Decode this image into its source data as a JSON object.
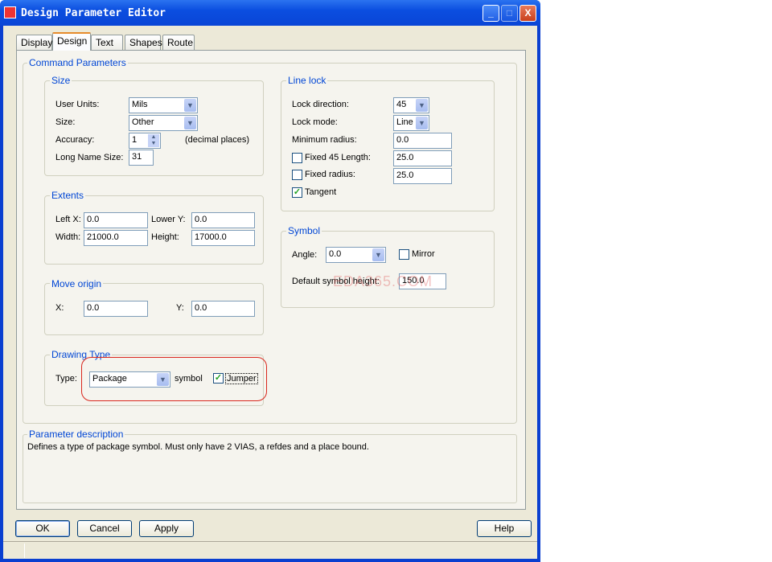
{
  "window": {
    "title": "Design Parameter Editor"
  },
  "tabs": [
    {
      "label": "Display"
    },
    {
      "label": "Design"
    },
    {
      "label": "Text"
    },
    {
      "label": "Shapes"
    },
    {
      "label": "Route"
    }
  ],
  "command_parameters": {
    "label": "Command Parameters"
  },
  "size": {
    "label": "Size",
    "user_units_label": "User Units:",
    "user_units": "Mils",
    "size_label": "Size:",
    "size": "Other",
    "accuracy_label": "Accuracy:",
    "accuracy": "1",
    "accuracy_hint": "(decimal places)",
    "long_name_label": "Long Name Size:",
    "long_name": "31"
  },
  "extents": {
    "label": "Extents",
    "left_x_label": "Left X:",
    "left_x": "0.0",
    "lower_y_label": "Lower Y:",
    "lower_y": "0.0",
    "width_label": "Width:",
    "width": "21000.0",
    "height_label": "Height:",
    "height": "17000.0"
  },
  "move_origin": {
    "label": "Move origin",
    "x_label": "X:",
    "x": "0.0",
    "y_label": "Y:",
    "y": "0.0"
  },
  "drawing_type": {
    "label": "Drawing Type",
    "type_label": "Type:",
    "type": "Package",
    "symbol_label": "symbol",
    "jumper_label": "Jumper",
    "jumper_checked": true
  },
  "line_lock": {
    "label": "Line lock",
    "lock_direction_label": "Lock direction:",
    "lock_direction": "45",
    "lock_mode_label": "Lock mode:",
    "lock_mode": "Line",
    "min_radius_label": "Minimum radius:",
    "min_radius": "0.0",
    "fixed45_label": "Fixed 45 Length:",
    "fixed45": "25.0",
    "fixed_radius_label": "Fixed radius:",
    "fixed_radius": "25.0",
    "tangent_label": "Tangent"
  },
  "symbol": {
    "label": "Symbol",
    "angle_label": "Angle:",
    "angle": "0.0",
    "mirror_label": "Mirror",
    "default_height_label": "Default symbol height:",
    "default_height": "150.0"
  },
  "watermark": "EDA365.COM",
  "description": {
    "label": "Parameter description",
    "text": "Defines a type of package symbol.  Must only have 2 VIAS, a refdes and a place bound."
  },
  "buttons": {
    "ok": "OK",
    "cancel": "Cancel",
    "apply": "Apply",
    "help": "Help"
  },
  "icons": {
    "check": "✓",
    "down": "▼",
    "min": "_",
    "max": "□",
    "close": "X"
  }
}
